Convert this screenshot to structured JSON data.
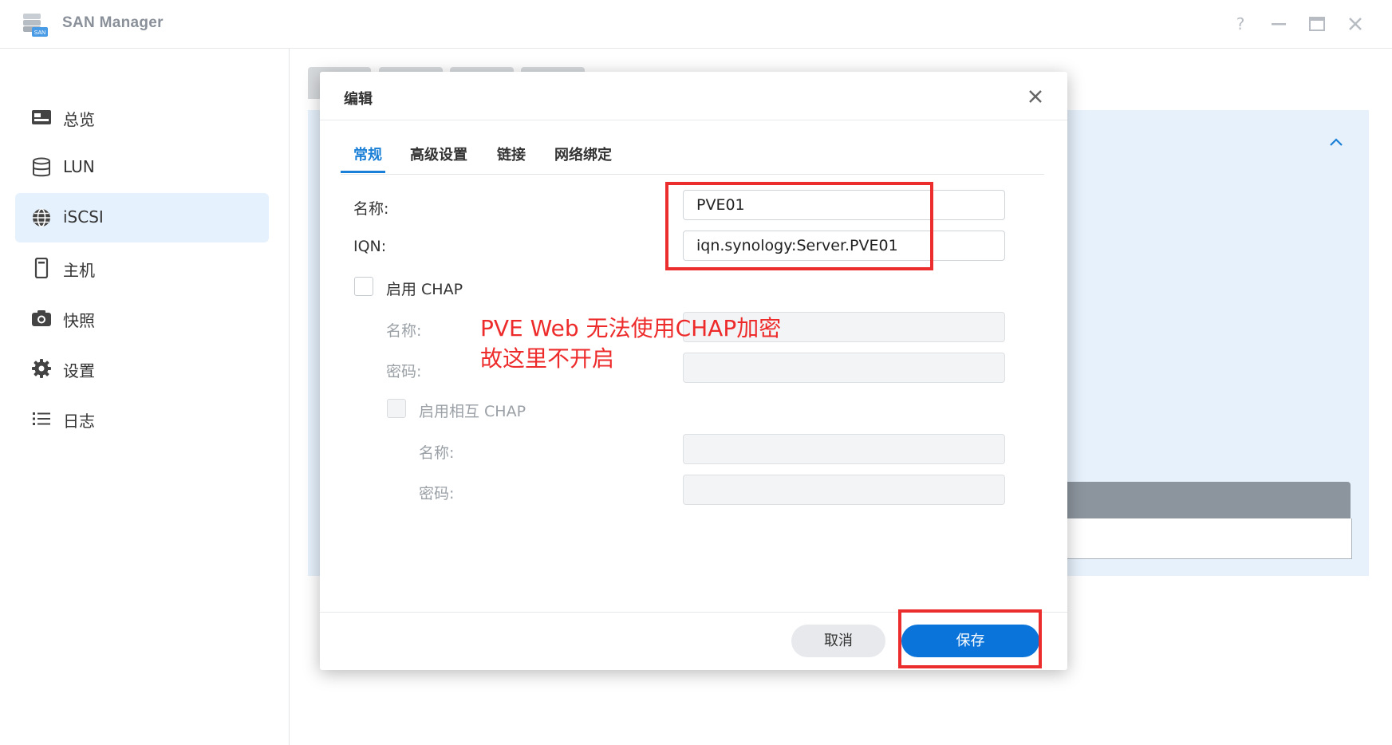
{
  "window": {
    "title": "SAN Manager",
    "controls": [
      "help-icon",
      "minimize-icon",
      "maximize-icon",
      "close-icon"
    ]
  },
  "sidebar": {
    "items": [
      {
        "label": "总览",
        "icon": "overview-icon"
      },
      {
        "label": "LUN",
        "icon": "database-icon"
      },
      {
        "label": "iSCSI",
        "icon": "globe-icon",
        "active": true
      },
      {
        "label": "主机",
        "icon": "host-icon"
      },
      {
        "label": "快照",
        "icon": "camera-icon"
      },
      {
        "label": "设置",
        "icon": "gear-icon"
      },
      {
        "label": "日志",
        "icon": "list-icon"
      }
    ]
  },
  "dialog": {
    "title": "编辑",
    "tabs": [
      {
        "label": "常规",
        "active": true
      },
      {
        "label": "高级设置"
      },
      {
        "label": "链接"
      },
      {
        "label": "网络绑定"
      }
    ],
    "fields": {
      "name_label": "名称:",
      "name_value": "PVE01",
      "iqn_label": "IQN:",
      "iqn_value": "iqn.synology:Server.PVE01",
      "chap_label": "启用 CHAP",
      "chap_name_label": "名称:",
      "chap_password_label": "密码:",
      "mutual_chap_label": "启用相互 CHAP",
      "mutual_name_label": "名称:",
      "mutual_password_label": "密码:"
    },
    "buttons": {
      "cancel": "取消",
      "save": "保存"
    }
  },
  "annotation": {
    "text": "PVE Web 无法使用CHAP加密\n故这里不开启",
    "color": "#ee2b2b"
  },
  "colors": {
    "accent": "#0a74da",
    "annotation_red": "#ec2d2d"
  }
}
